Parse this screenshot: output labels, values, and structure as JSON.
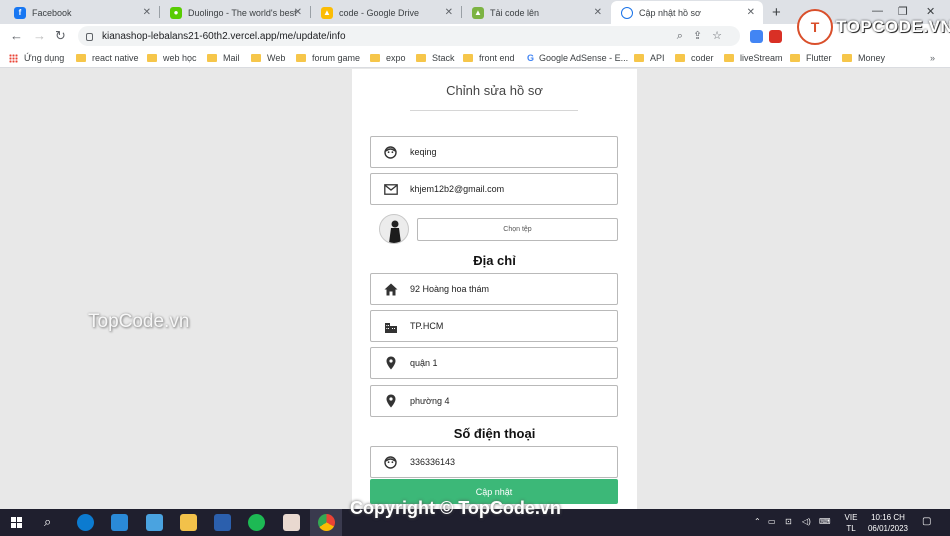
{
  "browser": {
    "tabs": [
      {
        "title": "Facebook",
        "icon": "facebook-icon",
        "color": "#1877f2",
        "glyph": "f"
      },
      {
        "title": "Duolingo - The world's best",
        "icon": "duolingo-icon",
        "color": "#58cc02",
        "glyph": "●"
      },
      {
        "title": "code - Google Drive",
        "icon": "google-drive-icon",
        "color": "#fbbc04",
        "glyph": "▲"
      },
      {
        "title": "Tải code lên",
        "icon": "upload-site-icon",
        "color": "#7cb342",
        "glyph": "▲"
      },
      {
        "title": "Cập nhật hồ sơ",
        "icon": "globe-icon",
        "color": "#1a73e8",
        "glyph": "◯"
      }
    ],
    "url": "kianashop-lebalans21-60th2.vercel.app/me/update/info",
    "bookmarks": [
      "Ứng dụng",
      "react native",
      "web học",
      "Mail",
      "Web",
      "forum game",
      "expo",
      "Stack",
      "front end",
      "Google AdSense - E...",
      "API",
      "coder",
      "liveStream",
      "Flutter",
      "Money"
    ]
  },
  "brand": {
    "logo_text": "T",
    "name": "TOPCODE.VN"
  },
  "form": {
    "title": "Chỉnh sửa hồ sơ",
    "username": "keqing",
    "email": "khjem12b2@gmail.com",
    "file_button": "Chọn tệp",
    "address_heading": "Địa chỉ",
    "street": "92 Hoàng hoa thám",
    "city": "TP.HCM",
    "district": "quận 1",
    "ward": "phường 4",
    "phone_heading": "Số điện thoại",
    "phone": "336336143",
    "submit": "Cập nhật"
  },
  "watermark": "TopCode.vn",
  "copyright": "Copyright © TopCode.vn",
  "taskbar": {
    "lang_top": "VIE",
    "lang_bottom": "TL",
    "time": "10:16 CH",
    "date": "06/01/2023"
  },
  "colors": {
    "accent_green": "#3cb878",
    "page_bg": "#e8e8e8"
  }
}
